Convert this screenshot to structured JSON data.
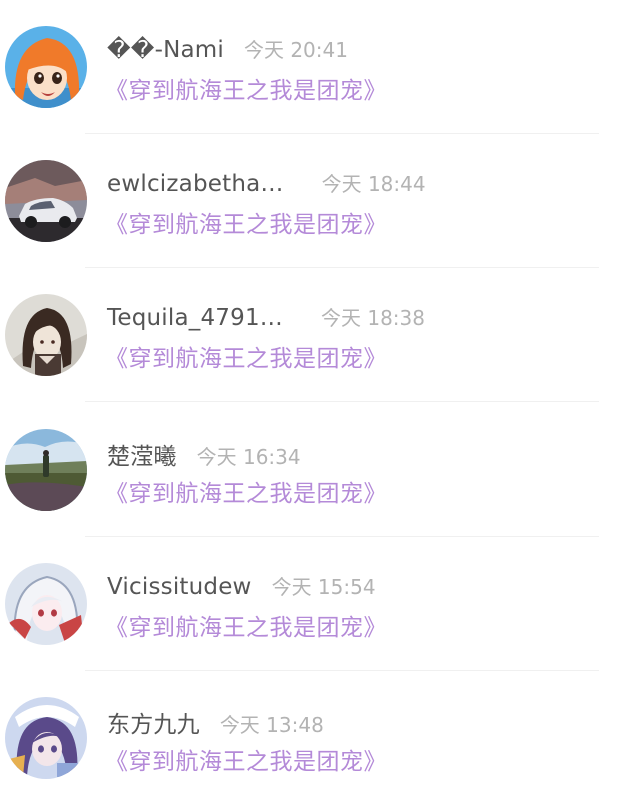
{
  "comments": [
    {
      "name": "��-Nami",
      "time": "今天 20:41",
      "book": "《穿到航海王之我是团宠》",
      "avatar": {
        "icon": "anime-orange-hair-avatar",
        "colors": [
          "#5ab1e8",
          "#f07a2a",
          "#fbe0c8"
        ]
      }
    },
    {
      "name": "ewlcizabetha…",
      "time": "今天 18:44",
      "book": "《穿到航海王之我是团宠》",
      "avatar": {
        "icon": "white-car-avatar",
        "colors": [
          "#6d5a5c",
          "#e9eaee",
          "#2d2a2e"
        ]
      }
    },
    {
      "name": "Tequila_4791…",
      "time": "今天 18:38",
      "book": "《穿到航海王之我是团宠》",
      "avatar": {
        "icon": "anime-dark-hair-boy-avatar",
        "colors": [
          "#dedcd6",
          "#3a2a22",
          "#efe4d8"
        ]
      }
    },
    {
      "name": "楚滢曦",
      "time": "今天 16:34",
      "book": "《穿到航海王之我是团宠》",
      "avatar": {
        "icon": "field-landscape-avatar",
        "colors": [
          "#8bb8dc",
          "#4e5a34",
          "#2f3a2a"
        ]
      }
    },
    {
      "name": "Vicissitudew",
      "time": "今天 15:54",
      "book": "《穿到航海王之我是团宠》",
      "avatar": {
        "icon": "anime-white-hair-girl-avatar",
        "colors": [
          "#dde4ef",
          "#c94545",
          "#9aa6bd"
        ]
      }
    },
    {
      "name": "东方九九",
      "time": "今天 13:48",
      "book": "《穿到航海王之我是团宠》",
      "avatar": {
        "icon": "anime-purple-hair-girl-avatar",
        "colors": [
          "#cdd8ef",
          "#5a4a8a",
          "#f3e6ea"
        ]
      }
    }
  ]
}
